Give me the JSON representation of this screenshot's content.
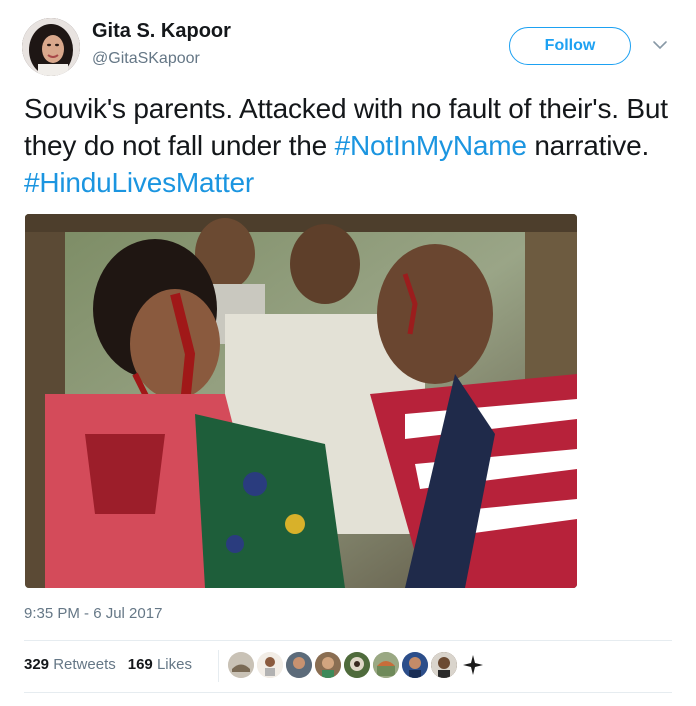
{
  "user": {
    "display_name": "Gita S. Kapoor",
    "handle": "@GitaSKapoor"
  },
  "follow_label": "Follow",
  "tweet": {
    "text_1": "Souvik's parents. Attacked with no fault of their's. But they do not fall under the ",
    "hashtag_1": "#NotInMyName",
    "text_2": " narrative. ",
    "hashtag_2": "#HinduLivesMatter",
    "timestamp": "9:35 PM - 6 Jul 2017"
  },
  "stats": {
    "retweets_count": "329",
    "retweets_label": "Retweets",
    "likes_count": "169",
    "likes_label": "Likes"
  },
  "likers": [
    {
      "icon": "liker-avatar-1",
      "color": "#c9c2b6"
    },
    {
      "icon": "liker-avatar-2",
      "color": "#e8e1d8"
    },
    {
      "icon": "liker-avatar-3",
      "color": "#5c6b7a"
    },
    {
      "icon": "liker-avatar-4",
      "color": "#8a6e52"
    },
    {
      "icon": "liker-avatar-5",
      "color": "#4f6b3c"
    },
    {
      "icon": "liker-avatar-6",
      "color": "#7f8f6a"
    },
    {
      "icon": "liker-avatar-7",
      "color": "#2c4e8a"
    },
    {
      "icon": "liker-avatar-8",
      "color": "#6d5a48"
    },
    {
      "icon": "liker-avatar-9",
      "color": "#ffffff"
    }
  ],
  "colors": {
    "accent": "#1da1f2",
    "hashtag": "#1b95e0",
    "muted": "#657786",
    "text": "#14171a"
  }
}
